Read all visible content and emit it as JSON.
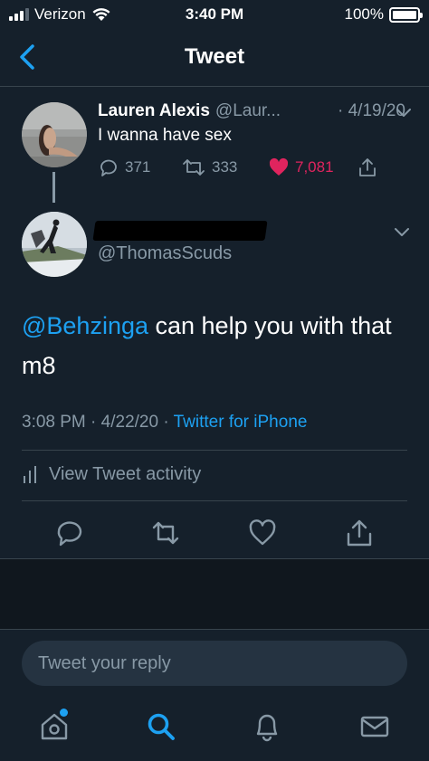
{
  "status_bar": {
    "carrier": "Verizon",
    "time": "3:40 PM",
    "battery": "100%",
    "icons": [
      "signal-icon",
      "wifi-icon",
      "battery-icon"
    ]
  },
  "nav": {
    "title": "Tweet",
    "back_icon": "back-chevron-icon"
  },
  "original_tweet": {
    "name": "Lauren Alexis",
    "handle": "@Laur...",
    "date": "· 4/19/20",
    "text": "I wanna have sex",
    "replies": "371",
    "retweets": "333",
    "likes": "7,081",
    "liked": true
  },
  "reply_tweet": {
    "handle": "@ThomasScuds",
    "mention": "@Behzinga",
    "text": " can help you with that m8",
    "time": "3:08 PM",
    "date": "4/22/20",
    "source": "Twitter for iPhone",
    "activity_label": "View Tweet activity"
  },
  "reply_box": {
    "placeholder": "Tweet your reply"
  },
  "tab_bar": {
    "tabs": [
      "home-icon",
      "search-icon",
      "notifications-icon",
      "messages-icon"
    ],
    "active": "search-icon"
  },
  "colors": {
    "background": "#15202b",
    "accent": "#1da1f2",
    "like": "#e0245e",
    "secondary_text": "#8899a6",
    "divider": "#38444d"
  }
}
